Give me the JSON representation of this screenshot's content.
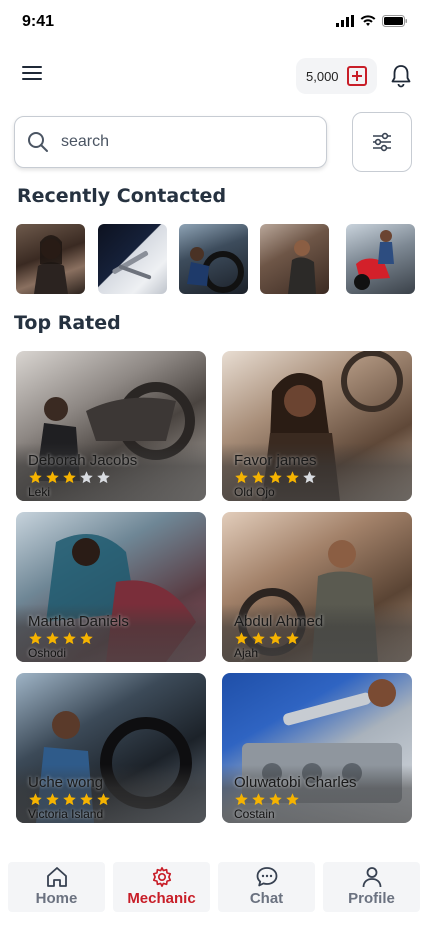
{
  "status_bar": {
    "time": "9:41"
  },
  "header": {
    "credits": "5,000"
  },
  "search": {
    "placeholder": "search"
  },
  "sections": {
    "recent_title": "Recently Contacted",
    "top_title": "Top Rated"
  },
  "recently_contacted": [
    {
      "name": "woman-in-workshop"
    },
    {
      "name": "tools-on-cloth"
    },
    {
      "name": "mechanic-fixing-wheel"
    },
    {
      "name": "mechanic-in-garage"
    },
    {
      "name": "red-scooter-repair"
    }
  ],
  "top_rated": [
    {
      "name": "Deborah Jacobs",
      "location": "Leki",
      "rating": 3,
      "max": 5
    },
    {
      "name": "Favor james",
      "location": "Old Ojo",
      "rating": 4,
      "max": 5
    },
    {
      "name": "Martha Daniels",
      "location": "Oshodi",
      "rating": 4,
      "max": 4
    },
    {
      "name": "Abdul Ahmed",
      "location": "Ajah",
      "rating": 4,
      "max": 4
    },
    {
      "name": "Uche wong",
      "location": "Victoria Island",
      "rating": 5,
      "max": 5
    },
    {
      "name": "Oluwatobi Charles",
      "location": "Costain",
      "rating": 4,
      "max": 4
    }
  ],
  "nav": {
    "home": "Home",
    "mechanic": "Mechanic",
    "chat": "Chat",
    "profile": "Profile"
  },
  "colors": {
    "accent": "#c81e28",
    "star": "#f5b301",
    "star_empty": "#d9dce1"
  }
}
